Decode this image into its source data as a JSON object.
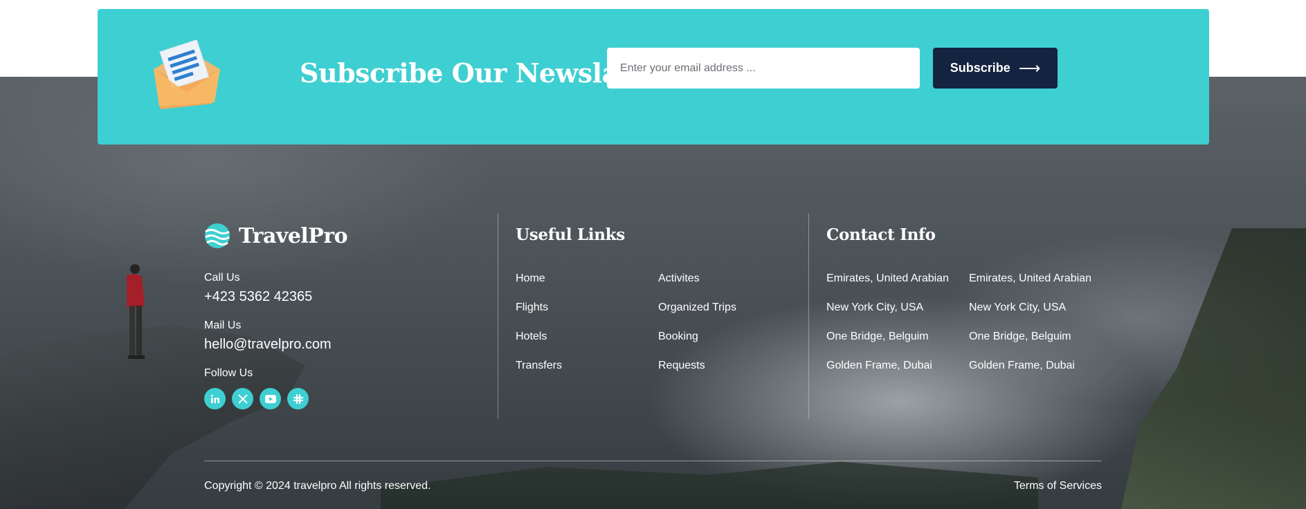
{
  "colors": {
    "accent": "#3ecfd2",
    "button_bg": "#142340",
    "text": "#ffffff"
  },
  "newsletter": {
    "title": "Subscribe Our Newslatter",
    "email_placeholder": "Enter your email address ...",
    "subscribe_label": "Subscribe",
    "icon": "envelope-icon"
  },
  "brand": {
    "name": "TravelPro",
    "icon": "waves-logo-icon"
  },
  "contact": {
    "call_label": "Call Us",
    "call_value": "+423 5362 42365",
    "mail_label": "Mail Us",
    "mail_value": "hello@travelpro.com",
    "follow_label": "Follow Us"
  },
  "socials": [
    {
      "name": "linkedin-icon",
      "glyph": "in"
    },
    {
      "name": "x-twitter-icon",
      "glyph": "𝕏"
    },
    {
      "name": "youtube-icon",
      "glyph": "▶"
    },
    {
      "name": "slack-icon",
      "glyph": "#"
    }
  ],
  "useful_links": {
    "title": "Useful Links",
    "col1": [
      "Home",
      "Flights",
      "Hotels",
      "Transfers"
    ],
    "col2": [
      "Activites",
      "Organized Trips",
      "Booking",
      "Requests"
    ]
  },
  "contact_info": {
    "title": "Contact Info",
    "col1": [
      "Emirates, United Arabian",
      "New York City, USA",
      "One Bridge, Belguim",
      "Golden Frame, Dubai"
    ],
    "col2": [
      "Emirates, United Arabian",
      "New York City, USA",
      "One Bridge, Belguim",
      "Golden Frame, Dubai"
    ]
  },
  "bottom": {
    "copyright": "Copyright © 2024 travelpro All rights reserved.",
    "terms": "Terms of Services"
  }
}
